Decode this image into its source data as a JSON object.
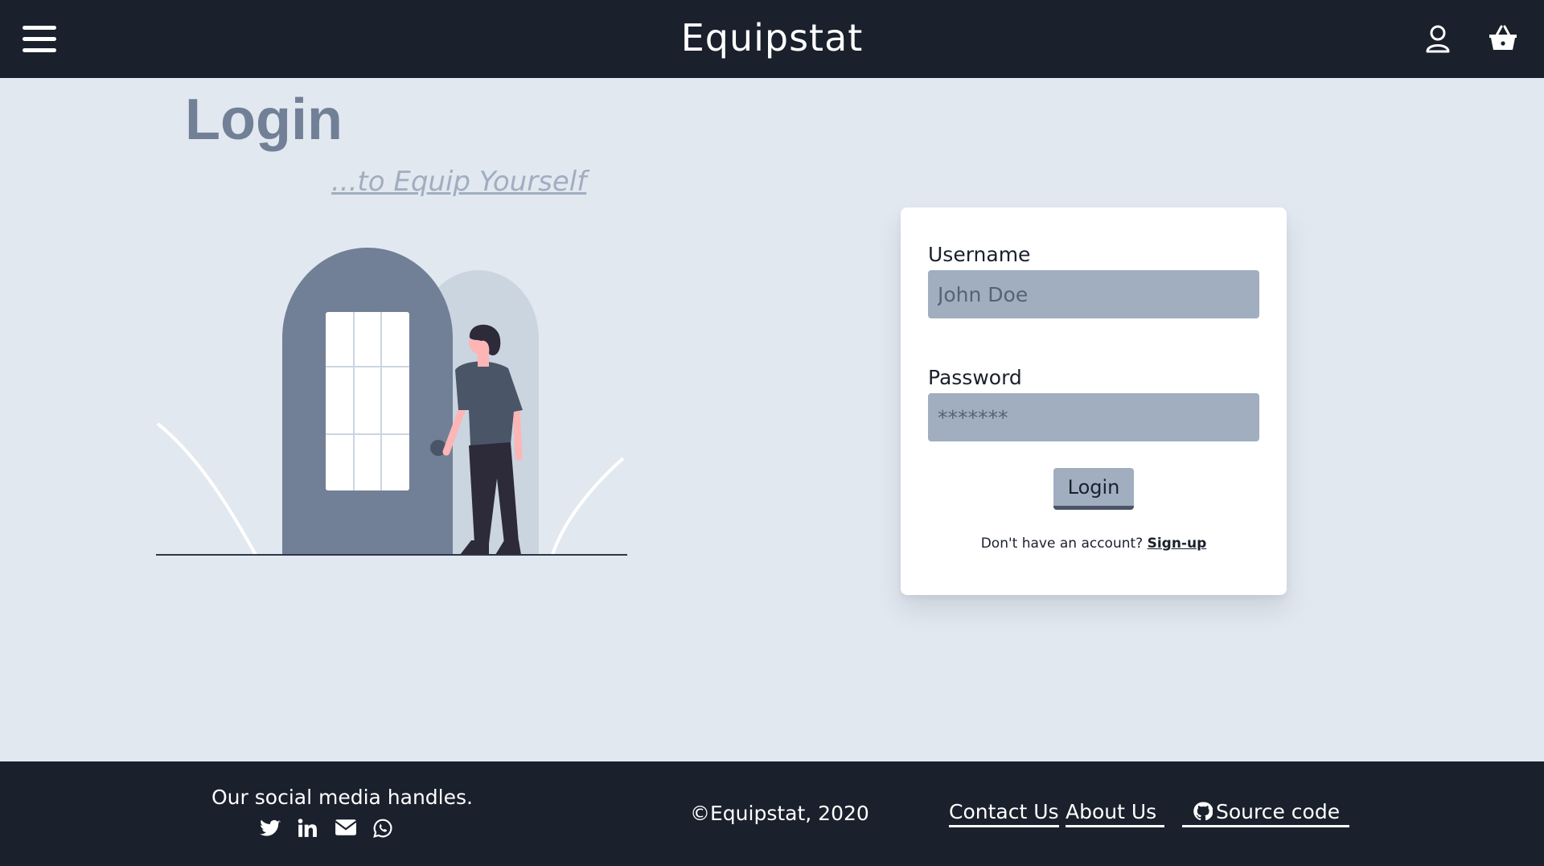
{
  "header": {
    "brand": "Equipstat",
    "icons": {
      "menu": "hamburger-menu-icon",
      "account": "user-icon",
      "cart": "shopping-basket-icon"
    }
  },
  "hero": {
    "title": "Login",
    "tagline": "...to Equip Yourself"
  },
  "form": {
    "username_label": "Username",
    "username_placeholder": "John Doe",
    "password_label": "Password",
    "password_placeholder": "*******",
    "submit_label": "Login",
    "signup_prompt": "Don't have an account?",
    "signup_link": "Sign-up"
  },
  "footer": {
    "social_title": "Our social media handles.",
    "social_icons": [
      "twitter-icon",
      "linkedin-icon",
      "envelope-icon",
      "whatsapp-icon"
    ],
    "copyright": "©Equipstat, 2020",
    "links": {
      "contact": "Contact Us",
      "about": "About Us",
      "source": "Source code"
    }
  },
  "colors": {
    "navbar": "#1a202c",
    "page_background": "#e2e8f0",
    "accent_gray": "#718096",
    "input_background": "#a0aec0",
    "card_background": "#ffffff"
  }
}
